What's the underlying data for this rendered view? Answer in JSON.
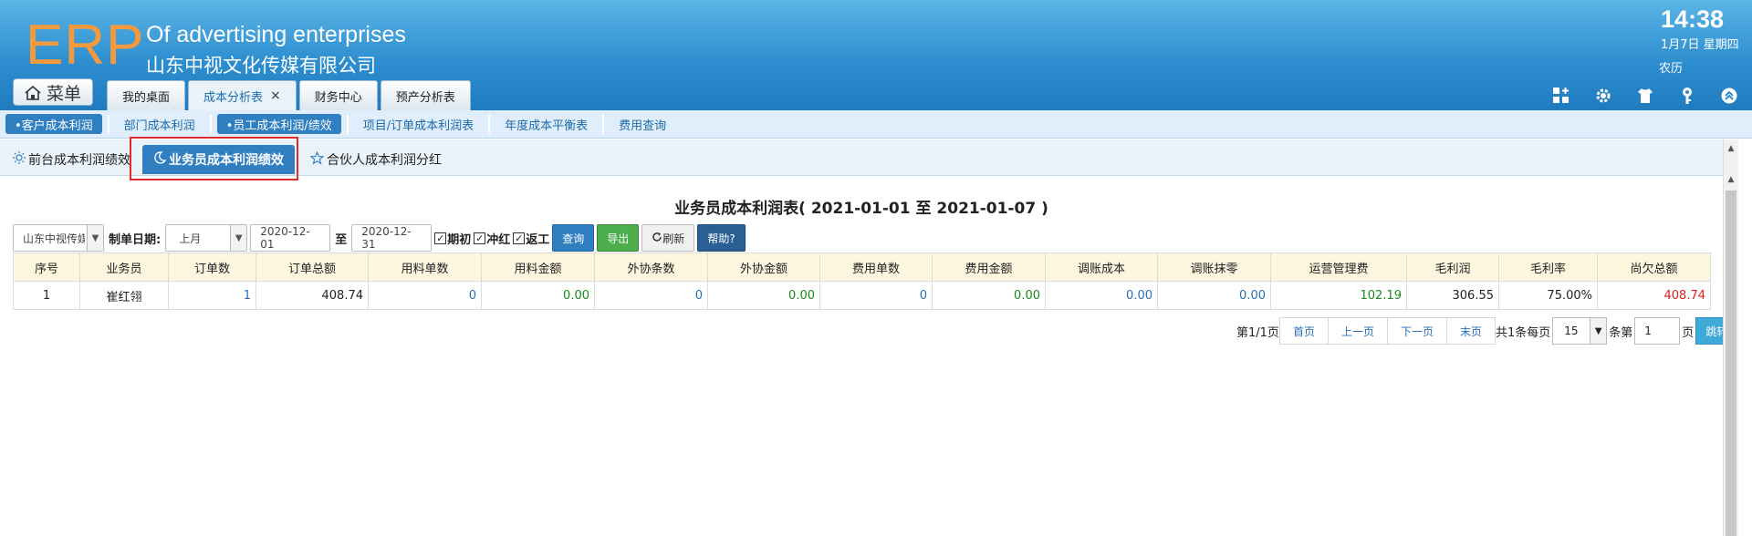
{
  "header": {
    "logo": "ERP",
    "company_en": "Of advertising enterprises",
    "company_cn": "山东中视文化传媒有限公司",
    "time": "14:38",
    "date": "1月7日 星期四",
    "lunar": "农历"
  },
  "menu_label": "菜单",
  "top_tabs": [
    {
      "label": "我的桌面",
      "active": false
    },
    {
      "label": "成本分析表",
      "active": true,
      "closable": true
    },
    {
      "label": "财务中心",
      "active": false
    },
    {
      "label": "预产分析表",
      "active": false
    }
  ],
  "close_glyph": "×",
  "subnav": [
    {
      "label": "•客户成本利润",
      "highlight": true
    },
    {
      "label": "部门成本利润",
      "highlight": false
    },
    {
      "label": "•员工成本利润/绩效",
      "highlight": true
    },
    {
      "label": "项目/订单成本利润表",
      "highlight": false
    },
    {
      "label": "年度成本平衡表",
      "highlight": false
    },
    {
      "label": "费用查询",
      "highlight": false
    }
  ],
  "inner_tabs": [
    {
      "label": "前台成本利润绩效",
      "icon": "sun-icon"
    },
    {
      "label": "业务员成本利润绩效",
      "icon": "moon-icon",
      "active": true
    },
    {
      "label": "合伙人成本利润分红",
      "icon": "star-icon"
    }
  ],
  "report_title": "业务员成本利润表( 2021-01-01 至 2021-01-07 )",
  "filters": {
    "company": "山东中视传媒",
    "date_label": "制单日期:",
    "period": "上月",
    "date_from": "2020-12-01",
    "to_label": "至",
    "date_to": "2020-12-31",
    "checks": [
      {
        "label": "期初",
        "checked": true
      },
      {
        "label": "冲红",
        "checked": true
      },
      {
        "label": "返工",
        "checked": true
      }
    ],
    "check_mark": "✓",
    "btn_query": "查询",
    "btn_export": "导出",
    "btn_refresh": "刷新",
    "btn_help": "帮助?"
  },
  "table": {
    "columns": [
      "序号",
      "业务员",
      "订单数",
      "订单总额",
      "用料单数",
      "用料金额",
      "外协条数",
      "外协金额",
      "费用单数",
      "费用金额",
      "调账成本",
      "调账抹零",
      "运营管理费",
      "毛利润",
      "毛利率",
      "尚欠总额"
    ],
    "rows": [
      [
        "1",
        "崔红翎",
        "1",
        "408.74",
        "0",
        "0.00",
        "0",
        "0.00",
        "0",
        "0.00",
        "0.00",
        "0.00",
        "102.19",
        "306.55",
        "75.00%",
        "408.74"
      ]
    ]
  },
  "pager": {
    "page_info": "第1/1页",
    "first": "首页",
    "prev": "上一页",
    "next": "下一页",
    "last": "末页",
    "total": "共1条每页",
    "per_page": "15",
    "per_unit": "条第",
    "page_input": "1",
    "page_unit": "页",
    "go": "跳转"
  },
  "colors": {
    "header_blue": "#2e8fd0",
    "logo_orange": "#f59a3c",
    "active_blue": "#2f7fc1",
    "value_blue": "#2a6fb5",
    "value_green": "#1a8a1a",
    "value_red": "#e02020",
    "highlight_red": "#e02b2b"
  }
}
